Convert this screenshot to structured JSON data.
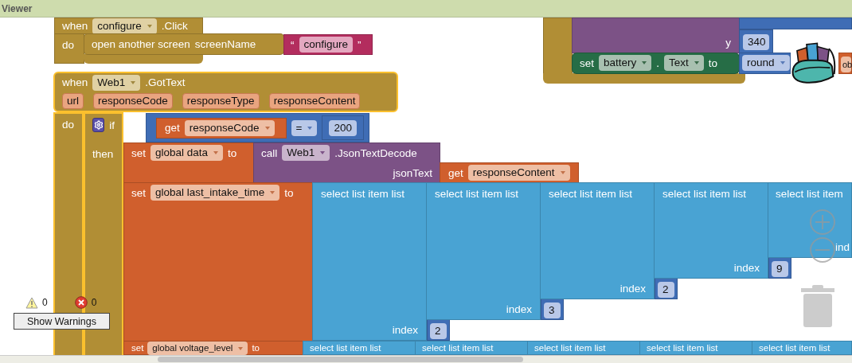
{
  "panel": {
    "title": "Viewer"
  },
  "configure_event": {
    "keyword": "when",
    "component": "configure",
    "event": ".Click",
    "do": "do",
    "statement": {
      "label": "open another screen",
      "socket": "screenName",
      "string": {
        "open": "“",
        "value": "configure",
        "close": "”"
      }
    }
  },
  "gottext_event": {
    "selected": true,
    "keyword": "when",
    "component": "Web1",
    "event": ".GotText",
    "params": [
      "url",
      "responseCode",
      "responseType",
      "responseContent"
    ],
    "do": "do",
    "if_block": {
      "keyword": "if",
      "then": "then",
      "condition": {
        "get": "get",
        "variable": "responseCode",
        "operator": "=",
        "value": "200"
      }
    },
    "statements": [
      {
        "kind": "call",
        "set": "set",
        "variable": "global data",
        "to": "to",
        "call": "call",
        "component": "Web1",
        "method": ".JsonTextDecode",
        "socket": "jsonText",
        "get": "get",
        "arg": "responseContent"
      },
      {
        "kind": "select",
        "set": "set",
        "variable": "global last_intake_time",
        "to": "to",
        "selects": [
          {
            "label": "select list item  list",
            "index_label": "index",
            "index": "2"
          },
          {
            "label": "select list item  list",
            "index_label": "index",
            "index": "3"
          },
          {
            "label": "select list item  list",
            "index_label": "index",
            "index": "2"
          },
          {
            "label": "select list item  list",
            "index_label": "index",
            "index": "9"
          },
          {
            "label": "select list item",
            "index_label": "ind"
          }
        ]
      },
      {
        "kind": "select",
        "set": "set",
        "variable": "global voltage_level",
        "to": "to",
        "selects": [
          {
            "label": "select list item  list"
          },
          {
            "label": "select list item  list"
          },
          {
            "label": "select list item  list"
          },
          {
            "label": "select list item  list"
          },
          {
            "label": "select list item  list"
          }
        ]
      }
    ]
  },
  "battery_event": {
    "y_label": "y",
    "y_value": "340",
    "set": "set",
    "component": "battery",
    "dot": ".",
    "property": "Text",
    "to": "to",
    "func": "round",
    "arg": "ob"
  },
  "warnings": {
    "warning_count": "0",
    "error_count": "0",
    "button": "Show Warnings"
  }
}
